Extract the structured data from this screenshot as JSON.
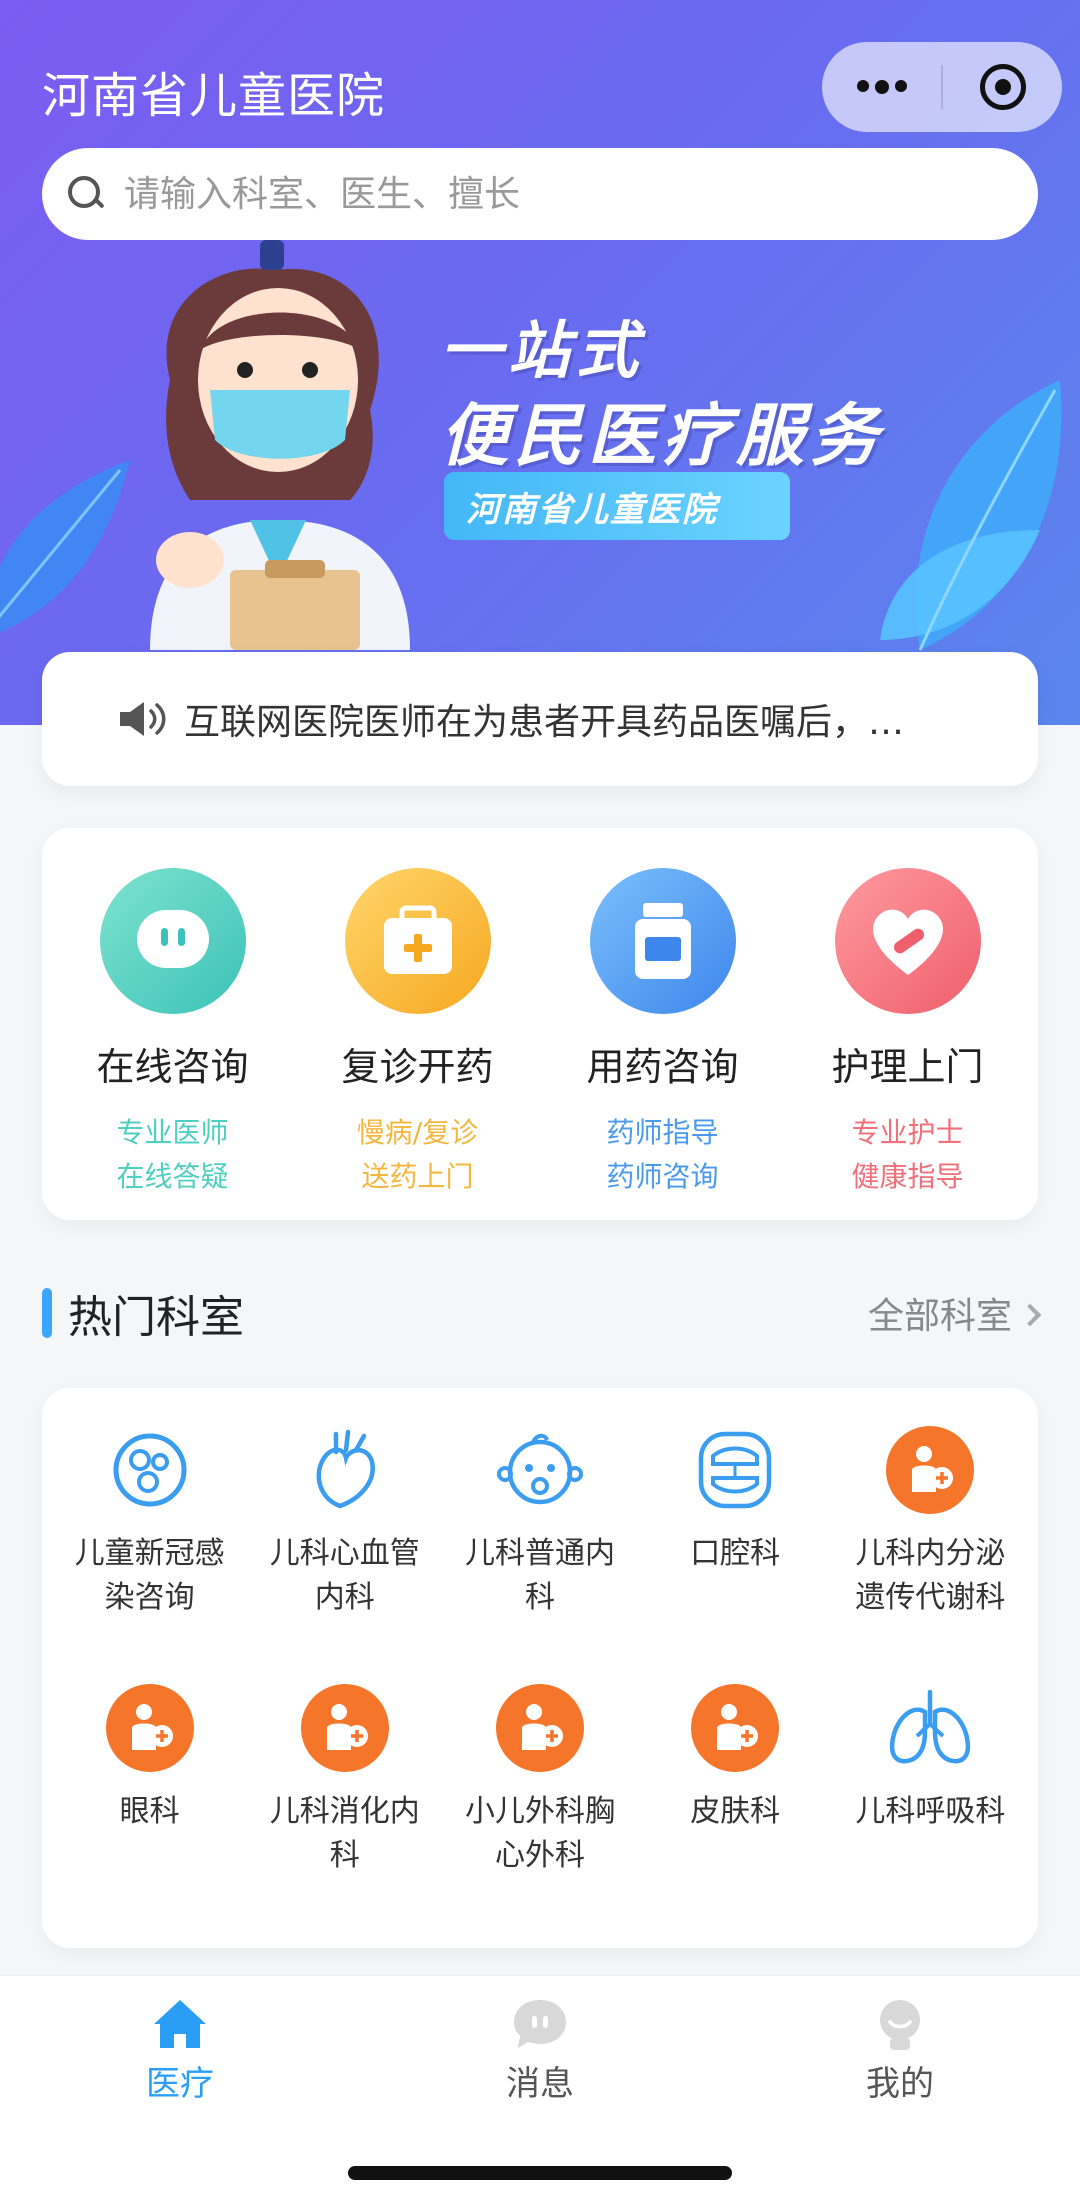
{
  "header": {
    "title": "河南省儿童医院",
    "search_placeholder": "请输入科室、医生、擅长"
  },
  "banner": {
    "headline1": "一站式",
    "headline2": "便民医疗服务",
    "tag": "河南省儿童医院"
  },
  "notice": {
    "text": "互联网医院医师在为患者开具药品医嘱后，…"
  },
  "services": [
    {
      "name": "在线咨询",
      "desc1": "专业医师",
      "desc2": "在线答疑",
      "color": "#4fcfc0",
      "icon": "chat-bubble-icon"
    },
    {
      "name": "复诊开药",
      "desc1": "慢病/复诊",
      "desc2": "送药上门",
      "color": "#f5b63d",
      "icon": "medicine-box-icon"
    },
    {
      "name": "用药咨询",
      "desc1": "药师指导",
      "desc2": "药师咨询",
      "color": "#4a9af0",
      "icon": "pill-bottle-icon"
    },
    {
      "name": "护理上门",
      "desc1": "专业护士",
      "desc2": "健康指导",
      "color": "#f2707a",
      "icon": "heart-pill-icon"
    }
  ],
  "section": {
    "title": "热门科室",
    "more": "全部科室"
  },
  "departments": [
    {
      "name": "儿童新冠感染咨询",
      "icon": "virus-icon"
    },
    {
      "name": "儿科心血管内科",
      "icon": "heart-organ-icon"
    },
    {
      "name": "儿科普通内科",
      "icon": "baby-face-icon"
    },
    {
      "name": "口腔科",
      "icon": "mouth-icon"
    },
    {
      "name": "儿科内分泌遗传代谢科",
      "icon": "doctor-badge-icon"
    },
    {
      "name": "眼科",
      "icon": "doctor-badge-icon"
    },
    {
      "name": "儿科消化内科",
      "icon": "doctor-badge-icon"
    },
    {
      "name": "小儿外科胸心外科",
      "icon": "doctor-badge-icon"
    },
    {
      "name": "皮肤科",
      "icon": "doctor-badge-icon"
    },
    {
      "name": "儿科呼吸科",
      "icon": "lungs-icon"
    }
  ],
  "tabbar": {
    "items": [
      {
        "label": "医疗",
        "active": true,
        "icon": "home-icon"
      },
      {
        "label": "消息",
        "active": false,
        "icon": "message-icon"
      },
      {
        "label": "我的",
        "active": false,
        "icon": "profile-icon"
      }
    ],
    "active_color": "#2a9ef5",
    "inactive_color": "#555555"
  },
  "colors": {
    "header_gradient_start": "#7c5cf2",
    "header_gradient_end": "#5a86ee",
    "accent": "#3ba6ff",
    "dept_orange": "#f5762a",
    "dept_blue": "#3a9df0"
  }
}
